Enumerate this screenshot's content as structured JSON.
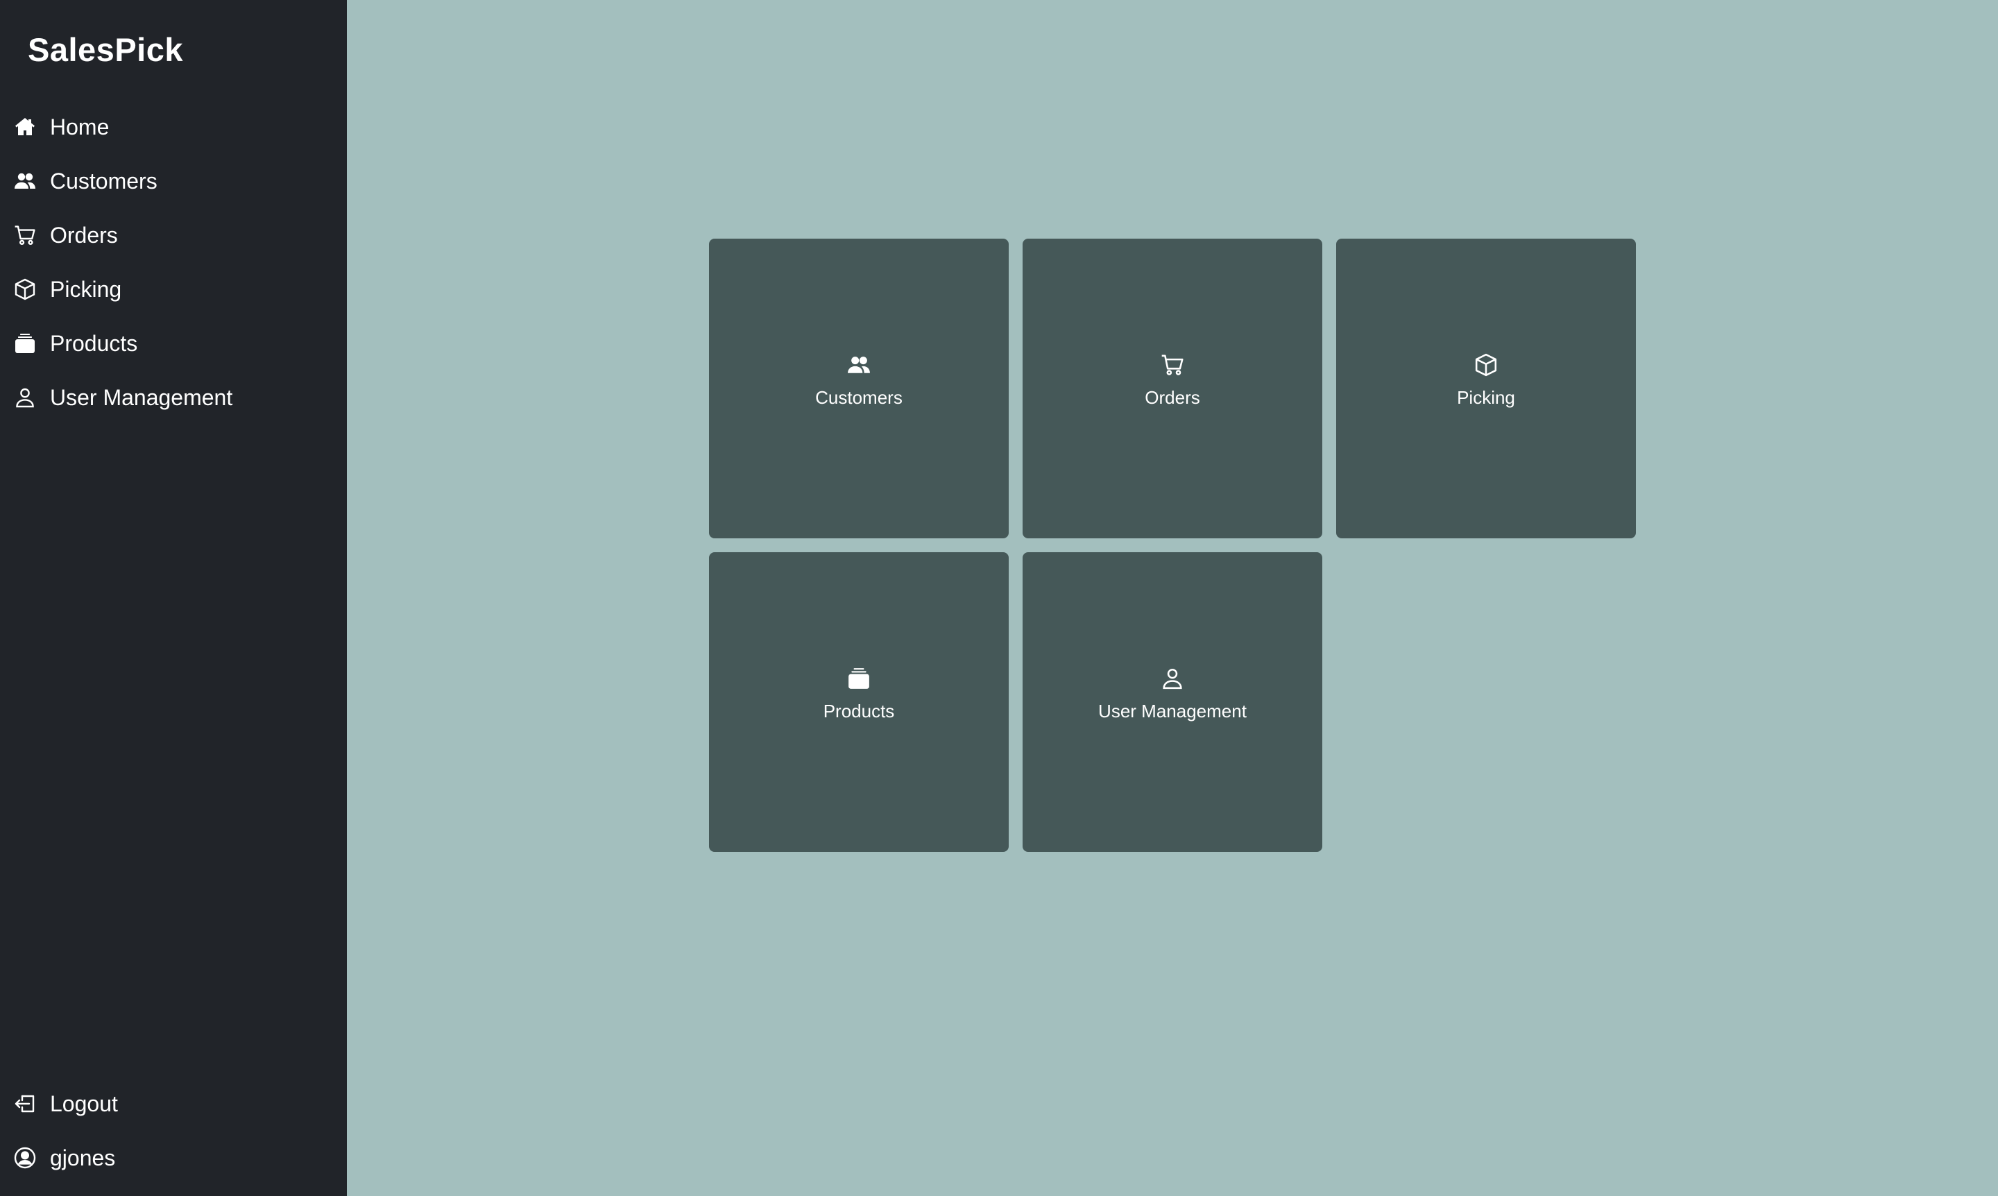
{
  "app": {
    "brand": "SalesPick"
  },
  "colors": {
    "sidebar_bg": "#212429",
    "main_bg": "#a3bfbe",
    "tile_bg": "#455858",
    "text": "#ffffff"
  },
  "sidebar": {
    "items": [
      {
        "label": "Home",
        "icon": "home-icon"
      },
      {
        "label": "Customers",
        "icon": "people-icon"
      },
      {
        "label": "Orders",
        "icon": "cart-icon"
      },
      {
        "label": "Picking",
        "icon": "box-icon"
      },
      {
        "label": "Products",
        "icon": "inbox-stack-icon"
      },
      {
        "label": "User Management",
        "icon": "person-icon"
      }
    ],
    "bottom": [
      {
        "label": "Logout",
        "icon": "logout-icon"
      },
      {
        "label": "gjones",
        "icon": "user-circle-icon"
      }
    ]
  },
  "tiles": [
    {
      "label": "Customers",
      "icon": "people-icon"
    },
    {
      "label": "Orders",
      "icon": "cart-icon"
    },
    {
      "label": "Picking",
      "icon": "box-icon"
    },
    {
      "label": "Products",
      "icon": "inbox-stack-icon"
    },
    {
      "label": "User Management",
      "icon": "person-icon"
    }
  ]
}
